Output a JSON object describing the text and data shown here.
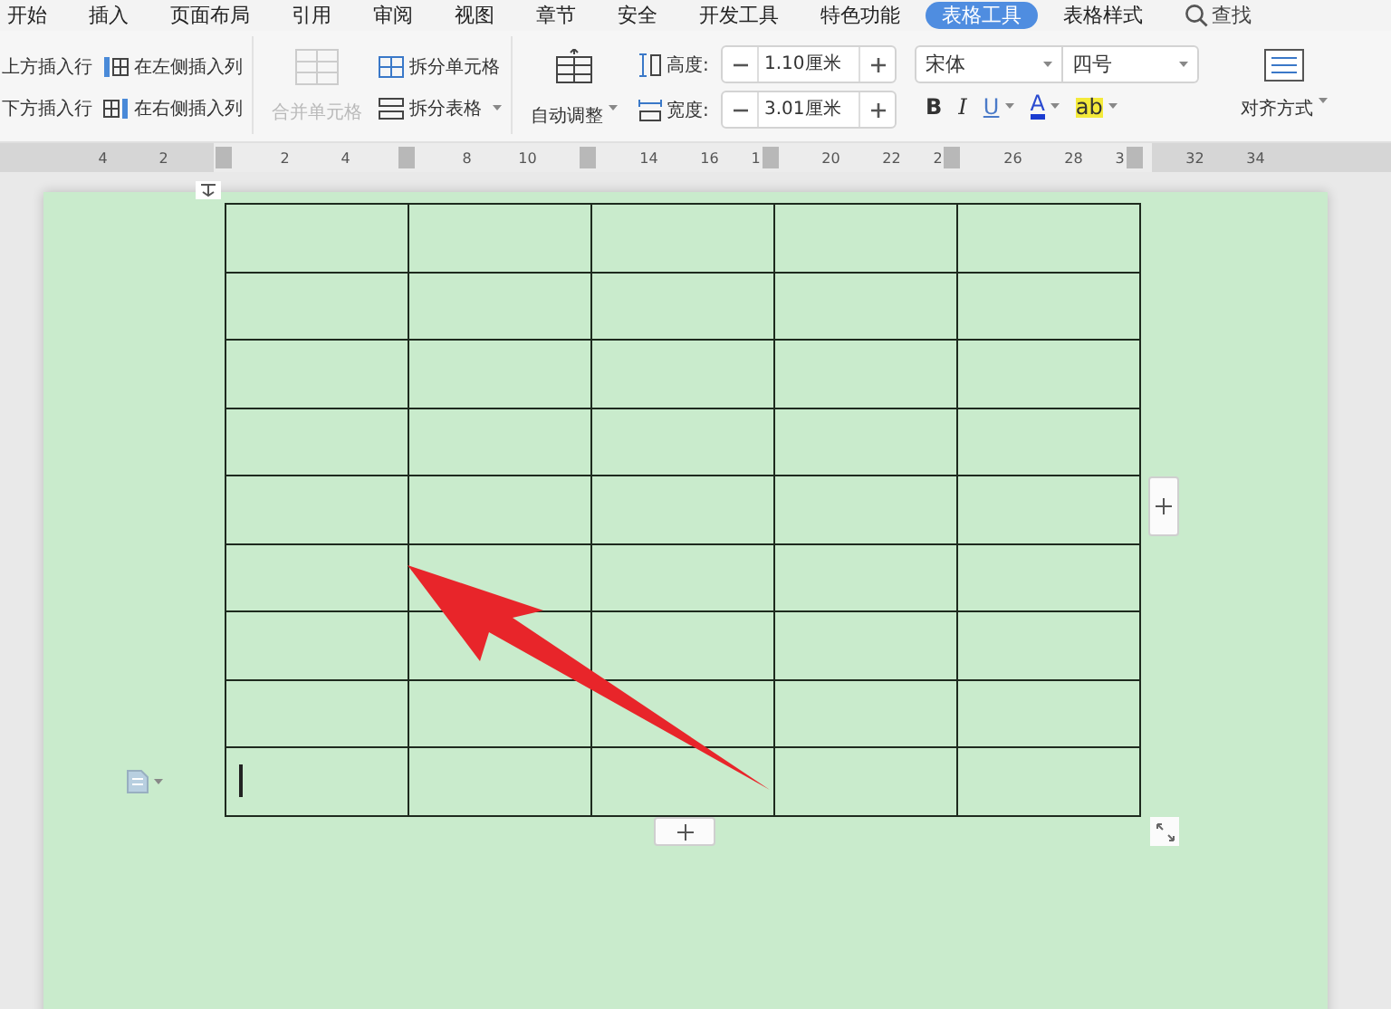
{
  "tabs": [
    {
      "label": "开始",
      "selected": false
    },
    {
      "label": "插入",
      "selected": false
    },
    {
      "label": "页面布局",
      "selected": false
    },
    {
      "label": "引用",
      "selected": false
    },
    {
      "label": "审阅",
      "selected": false
    },
    {
      "label": "视图",
      "selected": false
    },
    {
      "label": "章节",
      "selected": false
    },
    {
      "label": "安全",
      "selected": false
    },
    {
      "label": "开发工具",
      "selected": false
    },
    {
      "label": "特色功能",
      "selected": false
    },
    {
      "label": "表格工具",
      "selected": true
    },
    {
      "label": "表格样式",
      "selected": false
    }
  ],
  "search": {
    "label": "查找"
  },
  "ribbon": {
    "insert": [
      {
        "kind": "row",
        "label": "上方插入行"
      },
      {
        "kind": "row",
        "label": "下方插入行"
      },
      {
        "kind": "column_left",
        "label": "在左侧插入列"
      },
      {
        "kind": "column_right",
        "label": "在右侧插入列"
      }
    ],
    "merge": {
      "label": "合并单元格",
      "disabled": true
    },
    "split": [
      {
        "label": "拆分单元格",
        "dropdown": false
      },
      {
        "label": "拆分表格",
        "dropdown": true
      }
    ],
    "autofit": {
      "label": "自动调整",
      "dropdown": true
    },
    "size": [
      {
        "kind": "height",
        "label": "高度:",
        "value": "1.10厘米"
      },
      {
        "kind": "width",
        "label": "宽度:",
        "value": "3.01厘米"
      }
    ],
    "font": {
      "family": "宋体",
      "size": "四号"
    },
    "format": [
      {
        "kind": "bold",
        "label": "B",
        "dropdown": false
      },
      {
        "kind": "italic",
        "label": "I",
        "dropdown": false
      },
      {
        "kind": "underline",
        "label": "U",
        "dropdown": true
      },
      {
        "kind": "font_color",
        "label": "A",
        "dropdown": true
      },
      {
        "kind": "highlight",
        "label": "ab",
        "dropdown": true
      }
    ],
    "align": {
      "label": "对齐方式",
      "dropdown": true
    }
  },
  "ruler": [
    {
      "kind": "number",
      "text": "4"
    },
    {
      "kind": "number",
      "text": "2"
    },
    {
      "kind": "marker"
    },
    {
      "kind": "number",
      "text": "2"
    },
    {
      "kind": "number",
      "text": "4"
    },
    {
      "kind": "marker"
    },
    {
      "kind": "number",
      "text": "8"
    },
    {
      "kind": "number",
      "text": "10"
    },
    {
      "kind": "marker"
    },
    {
      "kind": "number",
      "text": "14"
    },
    {
      "kind": "number",
      "text": "16"
    },
    {
      "kind": "marker",
      "text": "1"
    },
    {
      "kind": "number",
      "text": "20"
    },
    {
      "kind": "number",
      "text": "22"
    },
    {
      "kind": "marker",
      "text": "2"
    },
    {
      "kind": "number",
      "text": "26"
    },
    {
      "kind": "number",
      "text": "28"
    },
    {
      "kind": "marker",
      "text": "3"
    },
    {
      "kind": "number",
      "text": "32"
    },
    {
      "kind": "number",
      "text": "34"
    }
  ],
  "table": {
    "rows": [
      {
        "cells": [
          {
            "cursor": false
          },
          {
            "cursor": false
          },
          {
            "cursor": false
          },
          {
            "cursor": false
          },
          {
            "cursor": false
          }
        ]
      },
      {
        "cells": [
          {
            "cursor": false
          },
          {
            "cursor": false
          },
          {
            "cursor": false
          },
          {
            "cursor": false
          },
          {
            "cursor": false
          }
        ]
      },
      {
        "cells": [
          {
            "cursor": false
          },
          {
            "cursor": false
          },
          {
            "cursor": false
          },
          {
            "cursor": false
          },
          {
            "cursor": false
          }
        ]
      },
      {
        "cells": [
          {
            "cursor": false
          },
          {
            "cursor": false
          },
          {
            "cursor": false
          },
          {
            "cursor": false
          },
          {
            "cursor": false
          }
        ]
      },
      {
        "cells": [
          {
            "cursor": false
          },
          {
            "cursor": false
          },
          {
            "cursor": false
          },
          {
            "cursor": false
          },
          {
            "cursor": false
          }
        ]
      },
      {
        "cells": [
          {
            "cursor": false
          },
          {
            "cursor": false
          },
          {
            "cursor": false
          },
          {
            "cursor": false
          },
          {
            "cursor": false
          }
        ]
      },
      {
        "cells": [
          {
            "cursor": false
          },
          {
            "cursor": false
          },
          {
            "cursor": false
          },
          {
            "cursor": false
          },
          {
            "cursor": false
          }
        ]
      },
      {
        "cells": [
          {
            "cursor": false
          },
          {
            "cursor": false
          },
          {
            "cursor": false
          },
          {
            "cursor": false
          },
          {
            "cursor": false
          }
        ]
      },
      {
        "cells": [
          {
            "cursor": true
          },
          {
            "cursor": false
          },
          {
            "cursor": false
          },
          {
            "cursor": false
          },
          {
            "cursor": false
          }
        ]
      }
    ]
  }
}
